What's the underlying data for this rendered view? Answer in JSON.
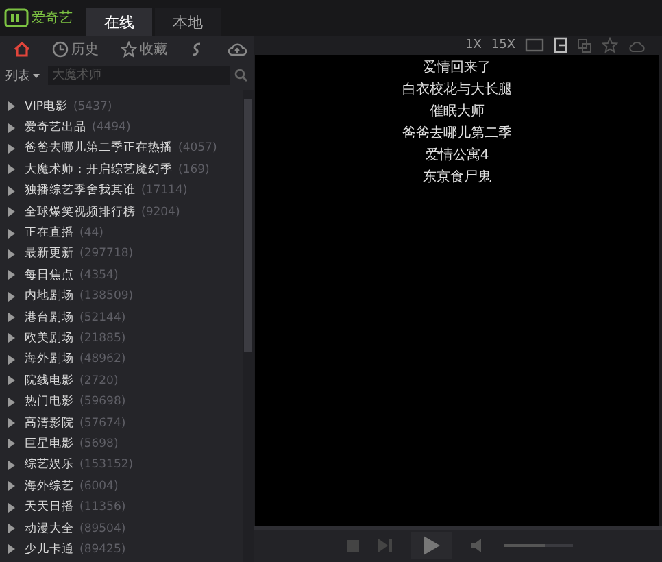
{
  "app": {
    "logo": "爱奇艺"
  },
  "tabs": [
    {
      "label": "在线",
      "selected": true
    },
    {
      "label": "本地",
      "selected": false
    }
  ],
  "nav": [
    {
      "kind": "home",
      "selected": true
    },
    {
      "kind": "history",
      "label": "历史",
      "selected": false
    },
    {
      "kind": "favorite",
      "label": "收藏",
      "selected": false
    },
    {
      "kind": "share",
      "selected": false
    },
    {
      "kind": "cloud",
      "selected": false
    }
  ],
  "list_menu": "列表",
  "search": {
    "placeholder": "大魔术师"
  },
  "categories": [
    {
      "name": "VIP电影",
      "count": "(5437)"
    },
    {
      "name": "爱奇艺出品",
      "count": "(4494)"
    },
    {
      "name": "爸爸去哪儿第二季正在热播",
      "count": "(4057)"
    },
    {
      "name": "大魔术师：开启综艺魔幻季",
      "count": "(169)"
    },
    {
      "name": "独播综艺季舍我其谁",
      "count": "(17114)"
    },
    {
      "name": "全球爆笑视频排行榜",
      "count": "(9204)"
    },
    {
      "name": "正在直播",
      "count": "(44)"
    },
    {
      "name": "最新更新",
      "count": "(297718)"
    },
    {
      "name": "每日焦点",
      "count": "(4354)"
    },
    {
      "name": "内地剧场",
      "count": "(138509)"
    },
    {
      "name": "港台剧场",
      "count": "(52144)"
    },
    {
      "name": "欧美剧场",
      "count": "(21885)"
    },
    {
      "name": "海外剧场",
      "count": "(48962)"
    },
    {
      "name": "院线电影",
      "count": "(2720)"
    },
    {
      "name": "热门电影",
      "count": "(59698)"
    },
    {
      "name": "高清影院",
      "count": "(57674)"
    },
    {
      "name": "巨星电影",
      "count": "(5698)"
    },
    {
      "name": "综艺娱乐",
      "count": "(153152)"
    },
    {
      "name": "海外综艺",
      "count": "(6004)"
    },
    {
      "name": "天天日播",
      "count": "(11356)"
    },
    {
      "name": "动漫大全",
      "count": "(89504)"
    },
    {
      "name": "少儿卡通",
      "count": "(89425)"
    }
  ],
  "speeds": [
    "1X",
    "15X"
  ],
  "progress": {
    "level": 0
  },
  "volume": {
    "level": 0.6
  },
  "video_titles": [
    "爱情回来了",
    "白衣校花与大长腿",
    "催眠大师",
    "爸爸去哪儿第二季",
    "爱情公寓4",
    "东京食尸鬼"
  ]
}
